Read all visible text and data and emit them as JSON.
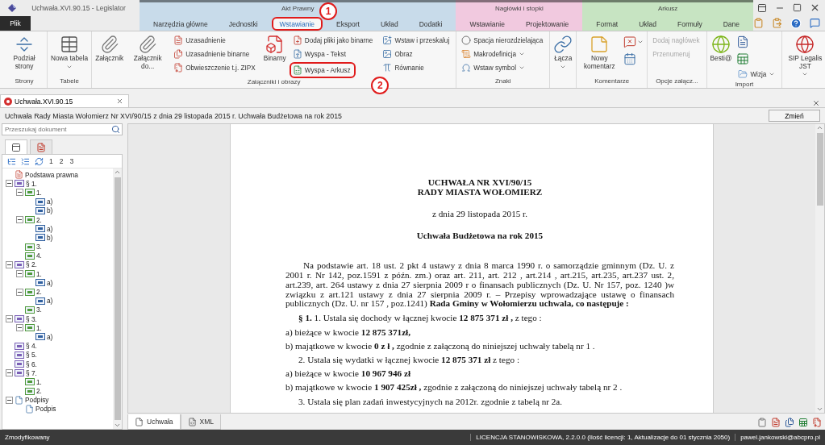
{
  "window": {
    "title": "Uchwała.XVI.90.15 - Legislator",
    "file_tab": "Plik"
  },
  "context_groups": [
    {
      "title": "Akt Prawny",
      "color": "#c8dbea",
      "tabs": [
        {
          "label": "Narzędzia główne",
          "selected": false
        },
        {
          "label": "Jednostki",
          "selected": false
        },
        {
          "label": "Wstawianie",
          "selected": true,
          "highlighted": true,
          "callout": "1"
        },
        {
          "label": "Eksport",
          "selected": false
        },
        {
          "label": "Układ",
          "selected": false
        },
        {
          "label": "Dodatki",
          "selected": false
        }
      ]
    },
    {
      "title": "Nagłówki i stopki",
      "color": "#f1c9df",
      "tabs": [
        {
          "label": "Wstawianie",
          "selected": false
        },
        {
          "label": "Projektowanie",
          "selected": false
        }
      ]
    },
    {
      "title": "Arkusz",
      "color": "#c7e4c2",
      "tabs": [
        {
          "label": "Format",
          "selected": false
        },
        {
          "label": "Układ",
          "selected": false
        },
        {
          "label": "Formuły",
          "selected": false
        },
        {
          "label": "Dane",
          "selected": false
        }
      ]
    }
  ],
  "ribbon": {
    "groups": [
      {
        "label": "Strony",
        "columns": [
          [
            {
              "kind": "large",
              "label": "Podział strony"
            }
          ]
        ]
      },
      {
        "label": "Tabele",
        "columns": [
          [
            {
              "kind": "large",
              "label": "Nowa tabela",
              "dropdown": true
            }
          ]
        ]
      },
      {
        "label": "Załączniki i obrazy",
        "columns": [
          [
            {
              "kind": "large",
              "label": "Załącznik"
            }
          ],
          [
            {
              "kind": "large",
              "label": "Załącznik do..."
            }
          ],
          [
            {
              "kind": "small",
              "label": "Uzasadnienie"
            },
            {
              "kind": "small",
              "label": "Uzasadnienie binarne"
            },
            {
              "kind": "small",
              "label": "Obwieszczenie t.j. ZIPX"
            }
          ],
          [
            {
              "kind": "large",
              "label": "Binarny"
            }
          ],
          [
            {
              "kind": "small",
              "label": "Dodaj pliki jako binarne"
            },
            {
              "kind": "small",
              "label": "Wyspa - Tekst"
            },
            {
              "kind": "small",
              "label": "Wyspa - Arkusz",
              "highlighted": true,
              "callout": "2"
            }
          ],
          [
            {
              "kind": "small",
              "label": "Wstaw i przeskaluj"
            },
            {
              "kind": "small",
              "label": "Obraz"
            },
            {
              "kind": "small",
              "label": "Równanie"
            }
          ]
        ]
      },
      {
        "label": "Znaki",
        "columns": [
          [
            {
              "kind": "small",
              "label": "Spacja nierozdzielająca"
            },
            {
              "kind": "small",
              "label": "Makrodefinicja",
              "dropdown": true
            },
            {
              "kind": "small",
              "label": "Wstaw symbol",
              "dropdown": true
            }
          ]
        ]
      },
      {
        "columns": [
          [
            {
              "kind": "large",
              "label": "Łącza",
              "dropdown": true
            }
          ]
        ]
      },
      {
        "label": "Komentarze",
        "columns": [
          [
            {
              "kind": "large",
              "label": "Nowy komentarz"
            }
          ],
          [
            {
              "kind": "icon",
              "dropdown": true
            },
            {
              "kind": "icon"
            }
          ]
        ]
      },
      {
        "label": "Opcje załącz...",
        "columns": [
          [
            {
              "kind": "text",
              "label": "Dodaj nagłówek",
              "disabled": true
            },
            {
              "kind": "text",
              "label": "Przenumeruj",
              "disabled": true
            }
          ]
        ]
      },
      {
        "label": "Import",
        "columns": [
          [
            {
              "kind": "large",
              "label": "Besti@"
            }
          ],
          [
            {
              "kind": "icon"
            },
            {
              "kind": "icon"
            },
            {
              "kind": "small",
              "label": "Wizja",
              "dropdown": true
            }
          ]
        ]
      },
      {
        "columns": [
          [
            {
              "kind": "large",
              "label": "SIP Legalis JST",
              "dropdown": true
            }
          ]
        ]
      }
    ]
  },
  "doc_tabs": [
    {
      "label": "Uchwała.XVI.90.15",
      "selected": true
    }
  ],
  "document_title": "Uchwała Rady Miasta Wołomierz Nr XVI/90/15 z dnia 29 listopada 2015 r. Uchwała Budżetowa na rok 2015",
  "change_button": "Zmień",
  "sidebar": {
    "search": {
      "placeholder": "Przeszukaj dokument"
    },
    "panel_tabs": [
      {
        "selected": true
      },
      {
        "selected": false
      }
    ],
    "levels": [
      "1",
      "2",
      "3"
    ],
    "tree": [
      {
        "label": "Podstawa prawna",
        "kind": "document"
      },
      {
        "label": "§ 1.",
        "kind": "paragraph",
        "expanded": true,
        "children": [
          {
            "label": "1.",
            "kind": "section",
            "expanded": true,
            "children": [
              {
                "label": "a)",
                "kind": "point"
              },
              {
                "label": "b)",
                "kind": "point"
              }
            ]
          },
          {
            "label": "2.",
            "kind": "section",
            "expanded": true,
            "children": [
              {
                "label": "a)",
                "kind": "point"
              },
              {
                "label": "b)",
                "kind": "point"
              }
            ]
          },
          {
            "label": "3.",
            "kind": "section"
          },
          {
            "label": "4.",
            "kind": "section"
          }
        ]
      },
      {
        "label": "§ 2.",
        "kind": "paragraph",
        "expanded": true,
        "children": [
          {
            "label": "1.",
            "kind": "section",
            "expanded": true,
            "children": [
              {
                "label": "a)",
                "kind": "point"
              }
            ]
          },
          {
            "label": "2.",
            "kind": "section",
            "expanded": true,
            "children": [
              {
                "label": "a)",
                "kind": "point"
              }
            ]
          },
          {
            "label": "3.",
            "kind": "section"
          }
        ]
      },
      {
        "label": "§ 3.",
        "kind": "paragraph",
        "expanded": true,
        "children": [
          {
            "label": "1.",
            "kind": "section",
            "expanded": true,
            "children": [
              {
                "label": "a)",
                "kind": "point"
              }
            ]
          }
        ]
      },
      {
        "label": "§ 4.",
        "kind": "paragraph"
      },
      {
        "label": "§ 5.",
        "kind": "paragraph"
      },
      {
        "label": "§ 6.",
        "kind": "paragraph"
      },
      {
        "label": "§ 7.",
        "kind": "paragraph",
        "expanded": true,
        "children": [
          {
            "label": "1.",
            "kind": "section"
          },
          {
            "label": "2.",
            "kind": "section"
          }
        ]
      },
      {
        "label": "Podpisy",
        "kind": "signature",
        "expanded": true,
        "children": [
          {
            "label": "Podpis",
            "kind": "signature"
          }
        ]
      }
    ]
  },
  "document": [
    {
      "kind": "title",
      "text": "UCHWAŁA NR XVI/90/15"
    },
    {
      "kind": "title",
      "text": "RADY MIASTA WOŁOMIERZ"
    },
    {
      "kind": "center",
      "text": "z dnia 29 listopada 2015 r."
    },
    {
      "kind": "heading",
      "text": "Uchwała Budżetowa na rok 2015"
    },
    {
      "kind": "para",
      "text": "Na podstawie art. 18 ust. 2 pkt 4 ustawy z dnia 8 marca 1990 r. o samorządzie gminnym (Dz. U. z 2001 r. Nr 142, poz.1591 z późn. zm.) oraz art. 211, art. 212 , art.214 , art.215, art.235, art.237 ust. 2, art.239, art. 264 ustawy z dnia 27 sierpnia 2009 r o finansach publicznych (Dz. U. Nr 157, poz. 1240 )w związku z art.121 ustawy z dnia 27 sierpnia 2009 r. – Przepisy wprowadzające ustawę o finansach publicznych (Dz. U. nr 157 , poz.1241) **Rada Gminy w Wołomierzu uchwala, co następuje :**"
    },
    {
      "kind": "indent",
      "text": "**§ 1.** 1. Ustala się dochody w łącznej kwocie **12 875 371 zł ,** z tego :"
    },
    {
      "kind": "line",
      "text": "a) bieżące w kwocie **12 875 371zł,**"
    },
    {
      "kind": "line",
      "text": "b) majątkowe w kwocie **0 z ł ,** zgodnie z załączoną do niniejszej uchwały tabelą nr 1 ."
    },
    {
      "kind": "indent",
      "text": "2. Ustala się wydatki w łącznej kwocie **12 875 371 zł** z tego :"
    },
    {
      "kind": "line",
      "text": "a) bieżące w kwocie **10 967 946 zł**"
    },
    {
      "kind": "line",
      "text": "b) majątkowe w kwocie **1 907 425zł ,** zgodnie z załączoną do niniejszej uchwały tabelą nr 2 ."
    },
    {
      "kind": "indent",
      "text": "3. Ustala się plan zadań inwestycyjnych na 2012r. zgodnie z tabelą nr 2a."
    }
  ],
  "view_tabs": [
    {
      "label": "Uchwała",
      "selected": true
    },
    {
      "label": "XML",
      "selected": false
    }
  ],
  "status_bar": {
    "state": "Zmodyfikowany",
    "license": "LICENCJA STANOWISKOWA, 2.2.0.0 (Ilość licencji: 1, Aktualizacje do 01 stycznia 2050)",
    "user": "pawel.jankowski@abcpro.pl"
  }
}
